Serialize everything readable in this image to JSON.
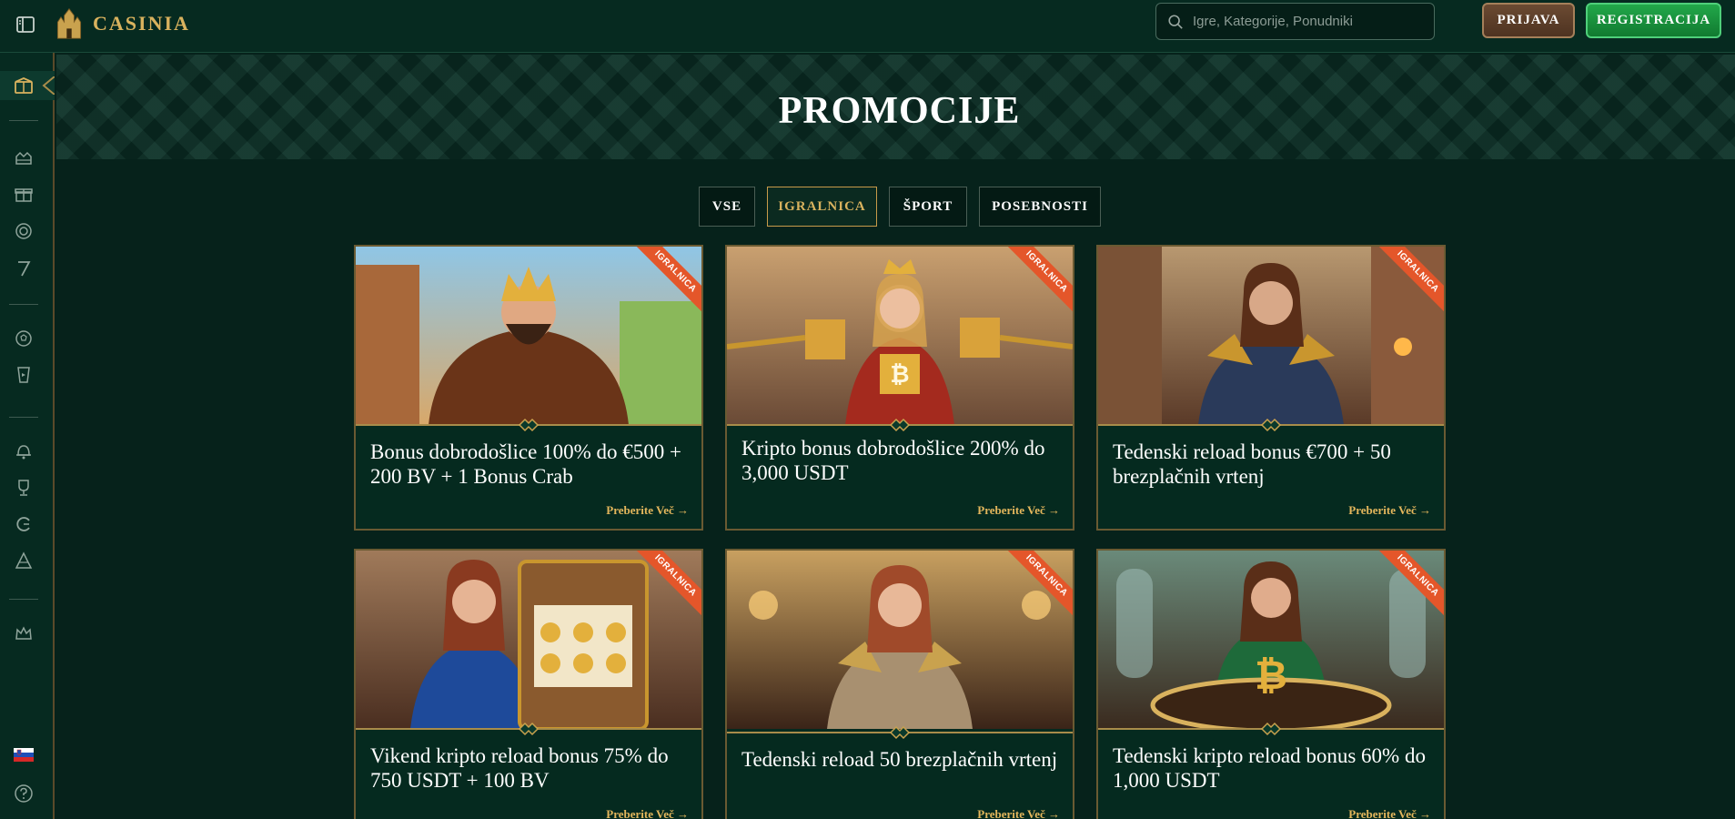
{
  "header": {
    "logo_text": "CASINIA",
    "search_placeholder": "Igre, Kategorije, Ponudniki",
    "login_label": "PRIJAVA",
    "register_label": "REGISTRACIJA"
  },
  "sidebar": {
    "icons": [
      "promotions-icon",
      "casino-icon",
      "gift-icon",
      "chip-icon",
      "seven-icon",
      "football-icon",
      "live-icon",
      "tournament-icon",
      "trophy-icon",
      "loyalty-icon",
      "vip-icon",
      "crown-icon"
    ],
    "language_flag": "slovenia-flag-icon"
  },
  "page": {
    "title": "PROMOCIJE"
  },
  "tabs": [
    {
      "label": "VSE",
      "active": false
    },
    {
      "label": "IGRALNICA",
      "active": true
    },
    {
      "label": "ŠPORT",
      "active": false
    },
    {
      "label": "POSEBNOSTI",
      "active": false
    }
  ],
  "promotions": [
    {
      "title": "Bonus dobrodošlice 100% do €500 + 200 BV + 1 Bonus Crab",
      "link": "Preberite Več →",
      "ribbon": "IGRALNICA"
    },
    {
      "title": "Kripto bonus dobrodošlice 200% do 3,000 USDT",
      "link": "Preberite Več →",
      "ribbon": "IGRALNICA"
    },
    {
      "title": "Tedenski reload bonus €700 + 50 brezplačnih vrtenj",
      "link": "Preberite Več →",
      "ribbon": "IGRALNICA"
    },
    {
      "title": "Vikend kripto reload bonus 75% do 750 USDT + 100 BV",
      "link": "Preberite Več →",
      "ribbon": "IGRALNICA"
    },
    {
      "title": "Tedenski reload 50 brezplačnih vrtenj",
      "link": "Preberite Več →",
      "ribbon": "IGRALNICA"
    },
    {
      "title": "Tedenski kripto reload bonus 60% do 1,000 USDT",
      "link": "Preberite Več →",
      "ribbon": "IGRALNICA"
    }
  ],
  "colors": {
    "background": "#06221b",
    "gold": "#d9b25e",
    "ribbon": "#e4562a",
    "register_green": "#22a84a"
  }
}
